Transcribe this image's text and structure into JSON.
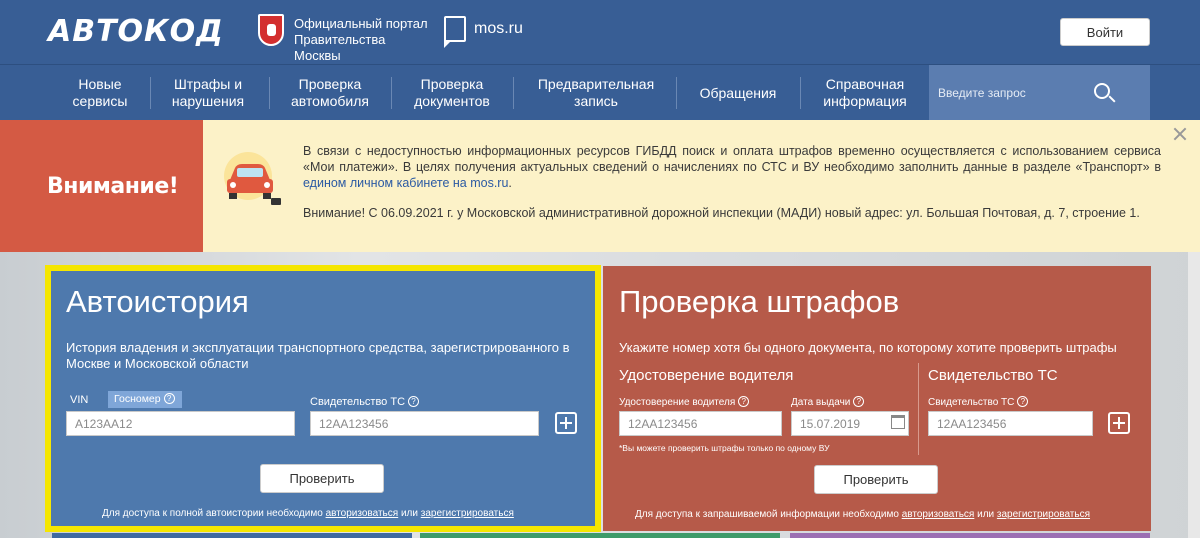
{
  "header": {
    "logo": "АВТОКОД",
    "portal_text": "Официальный портал Правительства Москвы",
    "mos_link": "mos.ru",
    "login_label": "Войти"
  },
  "nav": {
    "items": [
      {
        "label": "Новые сервисы"
      },
      {
        "label": "Штрафы и нарушения"
      },
      {
        "label": "Проверка автомобиля"
      },
      {
        "label": "Проверка документов"
      },
      {
        "label": "Предварительная запись"
      },
      {
        "label": "Обращения"
      },
      {
        "label": "Справочная информация"
      }
    ],
    "search_placeholder": "Введите запрос"
  },
  "alert": {
    "title": "Внимание!",
    "p1_before": "В связи с недоступностью информационных ресурсов ГИБДД поиск и оплата штрафов временно осуществляется с использованием сервиса «Мои платежи». В целях получения актуальных сведений о начислениях по СТС и ВУ необходимо заполнить данные в разделе «Транспорт» в ",
    "p1_link": "едином личном кабинете на mos.ru",
    "p1_after": ".",
    "p2": "Внимание! С 06.09.2021 г. у Московской административной дорожной инспекции (МАДИ) новый адрес: ул. Большая Почтовая, д. 7, строение 1."
  },
  "autohistory": {
    "title": "Автоистория",
    "description": "История владения и эксплуатации транспортного средства, зарегистрированного в Москве и Московской области",
    "tab_vin": "VIN",
    "tab_gosnomer": "Госномер",
    "gosnomer_placeholder": "А123АА12",
    "sts_label": "Свидетельство ТС",
    "sts_placeholder": "12АА123456",
    "check_label": "Проверить",
    "footer_text": "Для доступа к полной автоистории необходимо",
    "footer_link1": "авторизоваться",
    "footer_or": "или",
    "footer_link2": "зарегистрироваться"
  },
  "fines": {
    "title": "Проверка штрафов",
    "description": "Укажите номер хотя бы одного документа, по которому хотите проверить штрафы",
    "license_heading": "Удостоверение водителя",
    "license_label": "Удостоверение водителя",
    "license_placeholder": "12АА123456",
    "date_label": "Дата выдачи",
    "date_placeholder": "15.07.2019",
    "sts_heading": "Свидетельство ТС",
    "sts_label": "Свидетельство ТС",
    "sts_placeholder": "12АА123456",
    "note": "*Вы можете проверить штрафы только по одному ВУ",
    "check_label": "Проверить",
    "footer_text": "Для доступа к запрашиваемой информации необходимо",
    "footer_link1": "авторизоваться",
    "footer_or": "или",
    "footer_link2": "зарегистрироваться"
  },
  "colors": {
    "header_bg": "#385e95",
    "alert_red": "#d45a44",
    "alert_yellow": "#fcf2c8",
    "card_blue": "#4e79ad",
    "card_red": "#b65a49",
    "highlight": "#f5e600"
  }
}
